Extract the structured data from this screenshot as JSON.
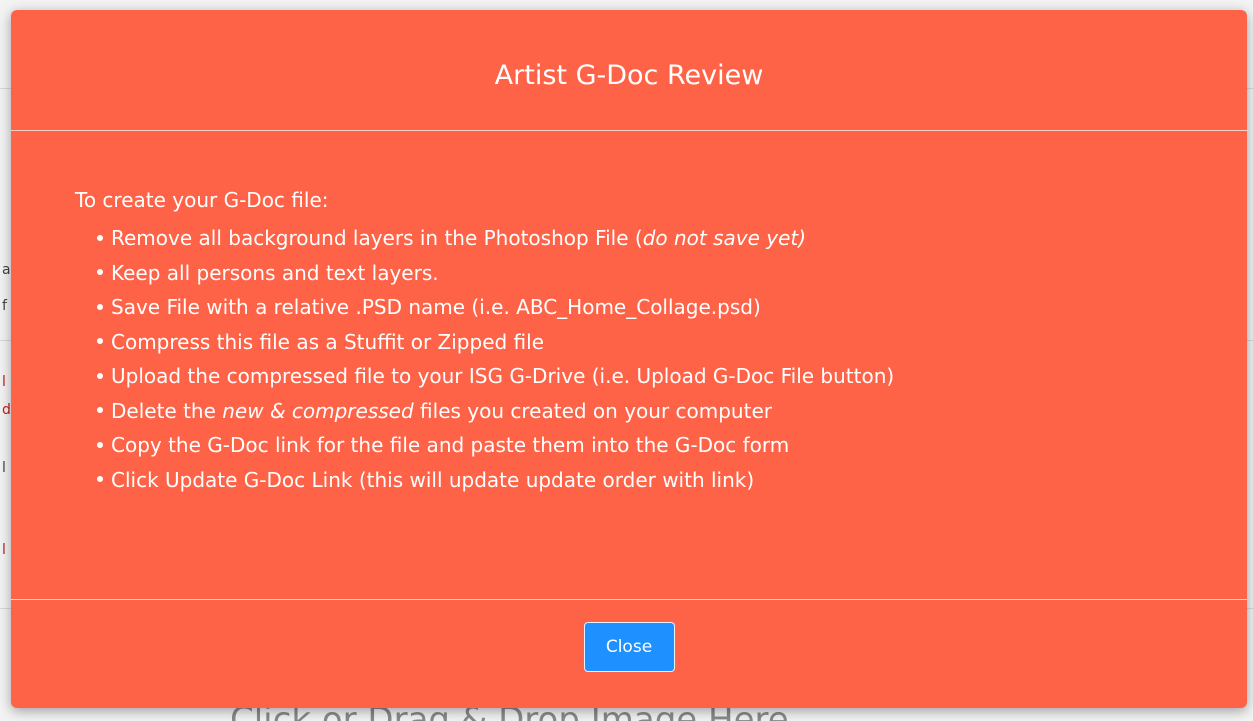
{
  "background": {
    "dropzone_text": "Click or Drag & Drop Image Here"
  },
  "modal": {
    "title": "Artist G-Doc Review",
    "intro": "To create your G-Doc file:",
    "steps": [
      {
        "text": "Remove all background layers in the Photoshop File (",
        "emphasis": "do not save yet)",
        "after": ""
      },
      {
        "text": "Keep all persons and text layers.",
        "emphasis": "",
        "after": ""
      },
      {
        "text": "Save File with a relative .PSD name (i.e. ABC_Home_Collage.psd)",
        "emphasis": "",
        "after": ""
      },
      {
        "text": "Compress this file as a Stuffit or Zipped file",
        "emphasis": "",
        "after": ""
      },
      {
        "text": "Upload the compressed file to your ISG G-Drive (i.e. Upload G-Doc File button)",
        "emphasis": "",
        "after": ""
      },
      {
        "text": "Delete the ",
        "emphasis": "new & compressed",
        "after": " files you created on your computer"
      },
      {
        "text": "Copy the G-Doc link for the file and paste them into the G-Doc form",
        "emphasis": "",
        "after": ""
      },
      {
        "text": "Click Update G-Doc Link (this will update update order with link)",
        "emphasis": "",
        "after": ""
      }
    ],
    "close_label": "Close"
  },
  "colors": {
    "modal_background": "#ff6347",
    "button_background": "#1e90ff",
    "text": "#ffffff"
  }
}
